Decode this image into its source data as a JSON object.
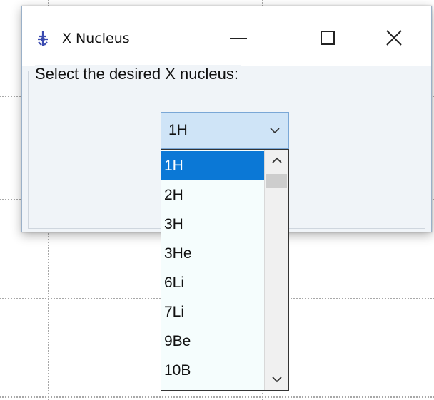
{
  "window": {
    "title": "X Nucleus",
    "icon": "app-icon",
    "controls": {
      "minimize": "minimize-icon",
      "maximize": "maximize-icon",
      "close": "close-icon"
    }
  },
  "group": {
    "label": "Select the desired X nucleus:"
  },
  "combo": {
    "selected_value": "1H"
  },
  "dropdown": {
    "options": [
      "1H",
      "2H",
      "3H",
      "3He",
      "6Li",
      "7Li",
      "9Be",
      "10B"
    ],
    "selected_index": 0
  },
  "colors": {
    "selection": "#0b78d6",
    "combo_bg": "#cfe4f7",
    "list_bg": "#f5fdfd"
  }
}
